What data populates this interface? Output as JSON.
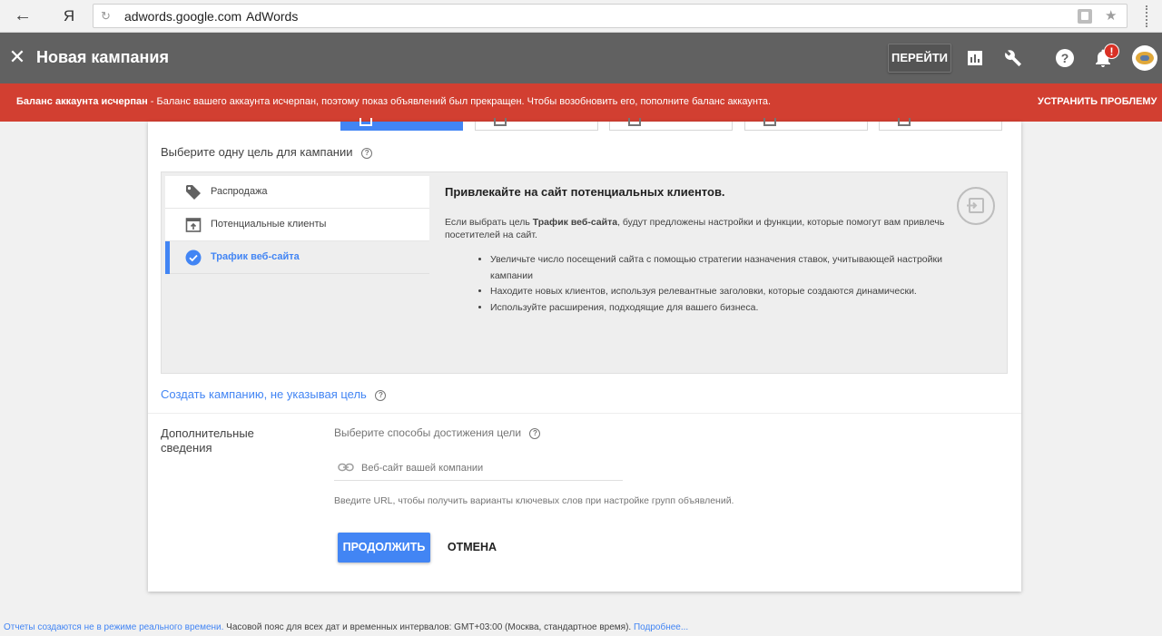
{
  "browser": {
    "back_glyph": "←",
    "yandex_glyph": "Я",
    "url_domain": "adwords.google.com",
    "page_title": "AdWords"
  },
  "header": {
    "title": "Новая кампания",
    "go_label": "ПЕРЕЙТИ",
    "notification_count": "!"
  },
  "alert": {
    "title": "Баланс аккаунта исчерпан",
    "message": " - Баланс вашего аккаунта исчерпан, поэтому показ объявлений был прекращен. Чтобы возобновить его, пополните баланс аккаунта.",
    "fix_label": "УСТРАНИТЬ ПРОБЛЕМУ"
  },
  "goals": {
    "heading": "Выберите одну цель для кампании",
    "items": [
      {
        "label": "Распродажа",
        "icon": "tag-icon"
      },
      {
        "label": "Потенциальные клиенты",
        "icon": "lead-form-icon"
      },
      {
        "label": "Трафик веб-сайта",
        "icon": "check-circle-icon",
        "selected": true
      }
    ],
    "description": {
      "title": "Привлекайте на сайт потенциальных клиентов.",
      "intro_before": "Если выбрать цель ",
      "intro_bold": "Трафик веб-сайта",
      "intro_after": ", будут предложены настройки и функции, которые помогут вам привлечь посетителей на сайт.",
      "bullets": [
        "Увеличьте число посещений сайта с помощью стратегии назначения ставок, учитывающей настройки кампании",
        "Находите новых клиентов, используя релевантные заголовки, которые создаются динамически.",
        "Используйте расширения, подходящие для вашего бизнеса."
      ]
    },
    "no_goal_link": "Создать кампанию, не указывая цель"
  },
  "extra": {
    "section_label": "Дополнительные сведения",
    "methods_label": "Выберите способы достижения цели",
    "url_placeholder": "Веб-сайт вашей компании",
    "url_value": "",
    "url_hint": "Введите URL, чтобы получить варианты ключевых слов при настройке групп объявлений."
  },
  "actions": {
    "continue_label": "ПРОДОЛЖИТЬ",
    "cancel_label": "ОТМЕНА"
  },
  "footer": {
    "part1": "Отчеты создаются не в режиме реального времени.",
    "part2": " Часовой пояс для всех дат и временных интервалов: GMT+03:00 (Москва, стандартное время).",
    "more_link": "Подробнее..."
  },
  "colors": {
    "header_bg": "#616161",
    "alert_bg": "#d23f31",
    "accent_blue": "#4285f4"
  }
}
